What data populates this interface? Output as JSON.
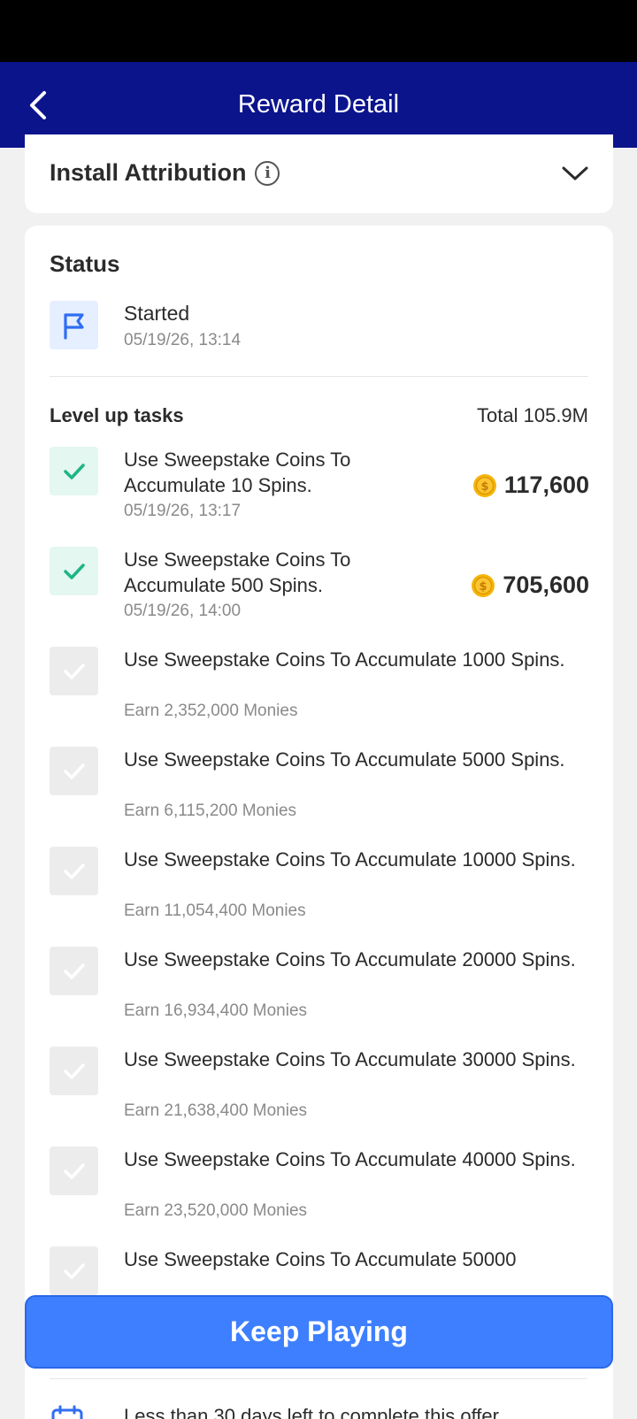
{
  "header": {
    "title": "Reward Detail"
  },
  "attribution": {
    "title": "Install Attribution"
  },
  "status": {
    "title": "Status",
    "started_label": "Started",
    "started_time": "05/19/26, 13:14"
  },
  "tasks": {
    "title": "Level up tasks",
    "total": "Total 105.9M",
    "items": [
      {
        "text": "Use Sweepstake Coins To Accumulate 10 Spins.",
        "sub": "05/19/26, 13:17",
        "reward": "117,600",
        "done": true
      },
      {
        "text": "Use Sweepstake Coins To Accumulate 500 Spins.",
        "sub": "05/19/26, 14:00",
        "reward": "705,600",
        "done": true
      },
      {
        "text": "Use Sweepstake Coins To Accumulate 1000 Spins.",
        "sub": "Earn 2,352,000 Monies",
        "done": false
      },
      {
        "text": "Use Sweepstake Coins To Accumulate 5000 Spins.",
        "sub": "Earn 6,115,200 Monies",
        "done": false
      },
      {
        "text": "Use Sweepstake Coins To Accumulate 10000 Spins.",
        "sub": "Earn 11,054,400 Monies",
        "done": false
      },
      {
        "text": "Use Sweepstake Coins To Accumulate 20000 Spins.",
        "sub": "Earn 16,934,400 Monies",
        "done": false
      },
      {
        "text": "Use Sweepstake Coins To Accumulate 30000 Spins.",
        "sub": "Earn 21,638,400 Monies",
        "done": false
      },
      {
        "text": "Use Sweepstake Coins To Accumulate 40000 Spins.",
        "sub": "Earn 23,520,000 Monies",
        "done": false
      },
      {
        "text": "Use Sweepstake Coins To Accumulate 50000",
        "sub": "",
        "done": false
      }
    ]
  },
  "footer": {
    "keep_playing": "Keep Playing",
    "deadline": "Less than 30 days left to complete this offer"
  },
  "colors": {
    "app_bar": "#0c148c",
    "primary_button": "#3d7fff",
    "check_done_bg": "#e4f7f1",
    "check_done": "#1db584",
    "check_todo_bg": "#ececec",
    "coin": "#f5b50a"
  }
}
